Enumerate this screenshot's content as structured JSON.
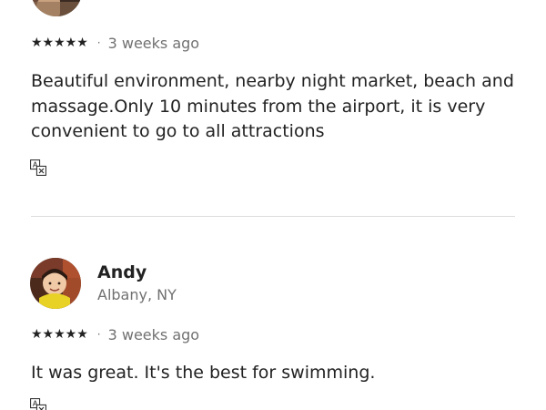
{
  "reviews": [
    {
      "rating": "★★★★★",
      "separator": "·",
      "date": "3 weeks ago",
      "text": "Beautiful environment, nearby night market, beach and massage.Only 10 minutes from the airport, it is very convenient to go to all attractions",
      "translate_icon": "translate-icon"
    },
    {
      "name": "Andy",
      "location": "Albany, NY",
      "rating": "★★★★★",
      "separator": "·",
      "date": "3 weeks ago",
      "text": "It was great. It's the best for swimming.",
      "translate_icon": "translate-icon"
    }
  ],
  "colors": {
    "text_primary": "#222222",
    "text_secondary": "#717171",
    "divider": "#dddddd"
  }
}
